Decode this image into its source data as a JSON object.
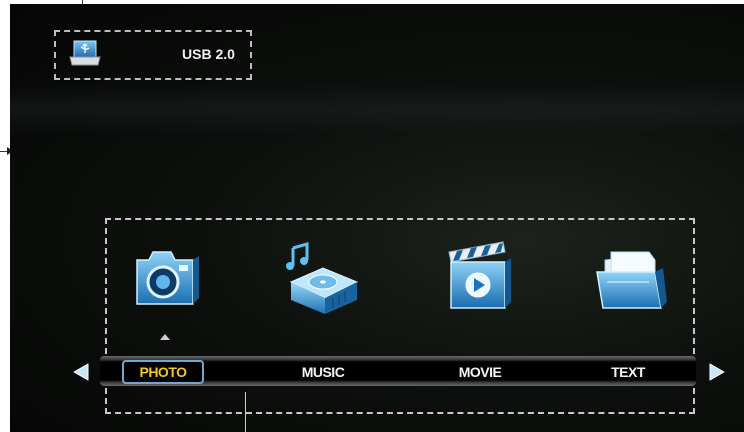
{
  "source": {
    "label": "USB 2.0",
    "icon": "usb-drive-icon"
  },
  "menu": {
    "selected": "PHOTO",
    "tabs": [
      {
        "label": "PHOTO",
        "icon": "camera-icon"
      },
      {
        "label": "MUSIC",
        "icon": "music-player-icon"
      },
      {
        "label": "MOVIE",
        "icon": "clapperboard-icon"
      },
      {
        "label": "TEXT",
        "icon": "folder-icon"
      }
    ],
    "nav": {
      "left": "arrow-left-icon",
      "right": "arrow-right-icon"
    }
  },
  "colors": {
    "background": "#0a0c0a",
    "selected_text": "#f0c52e",
    "selection_border": "#6fa9cf",
    "icon_blue": "#3aa0dc",
    "label_text": "#f4f4f4"
  }
}
